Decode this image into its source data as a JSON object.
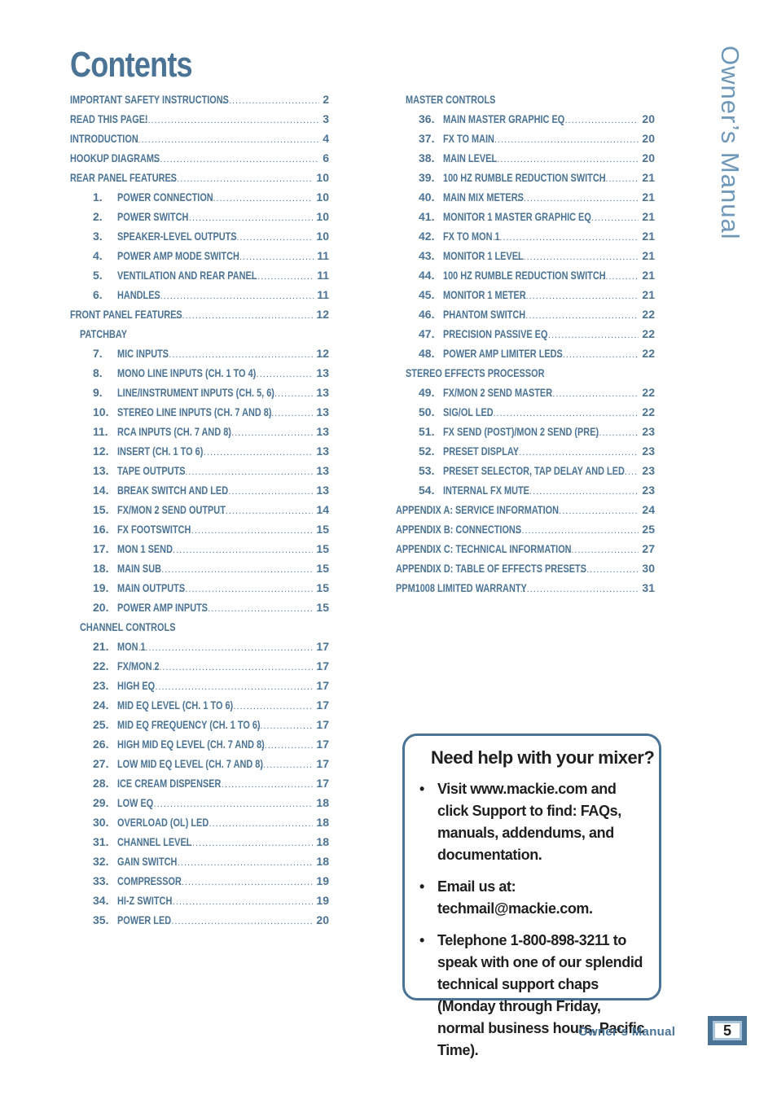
{
  "header": {
    "title": "Contents",
    "side_title": "Owner’s Manual"
  },
  "toc_left": [
    {
      "level": 0,
      "num": "",
      "text": "IMPORTANT SAFETY INSTRUCTIONS",
      "page": "2"
    },
    {
      "level": 0,
      "num": "",
      "text": "READ THIS PAGE!",
      "page": "3"
    },
    {
      "level": 0,
      "num": "",
      "text": "INTRODUCTION",
      "page": "4"
    },
    {
      "level": 0,
      "num": "",
      "text": "HOOKUP DIAGRAMS",
      "page": "6"
    },
    {
      "level": 0,
      "num": "",
      "text": "REAR PANEL FEATURES",
      "page": "10"
    },
    {
      "level": 2,
      "num": "1.",
      "text": "POWER CONNECTION",
      "page": "10"
    },
    {
      "level": 2,
      "num": "2.",
      "text": "POWER SWITCH",
      "page": "10"
    },
    {
      "level": 2,
      "num": "3.",
      "text": "SPEAKER-LEVEL OUTPUTS",
      "page": "10"
    },
    {
      "level": 2,
      "num": "4.",
      "text": "POWER AMP MODE SWITCH",
      "page": "11"
    },
    {
      "level": 2,
      "num": "5.",
      "text": "VENTILATION AND REAR PANEL",
      "page": "11"
    },
    {
      "level": 2,
      "num": "6.",
      "text": "HANDLES",
      "page": "11"
    },
    {
      "level": 0,
      "num": "",
      "text": "FRONT PANEL FEATURES",
      "page": "12"
    },
    {
      "level": 1,
      "num": "",
      "text": "PATCHBAY",
      "page": ""
    },
    {
      "level": 2,
      "num": "7.",
      "text": "MIC INPUTS",
      "page": "12"
    },
    {
      "level": 2,
      "num": "8.",
      "text": "MONO LINE INPUTS (CH. 1 TO 4)",
      "page": "13"
    },
    {
      "level": 2,
      "num": "9.",
      "text": "LINE/INSTRUMENT INPUTS (CH. 5, 6)",
      "page": "13"
    },
    {
      "level": 2,
      "num": "10.",
      "text": "STEREO LINE INPUTS (CH. 7 AND 8)",
      "page": "13"
    },
    {
      "level": 2,
      "num": "11.",
      "text": "RCA INPUTS (CH. 7 AND 8)",
      "page": "13"
    },
    {
      "level": 2,
      "num": "12.",
      "text": "INSERT (CH. 1 TO 6)",
      "page": "13"
    },
    {
      "level": 2,
      "num": "13.",
      "text": "TAPE OUTPUTS",
      "page": "13"
    },
    {
      "level": 2,
      "num": "14.",
      "text": "BREAK SWITCH AND LED",
      "page": "13"
    },
    {
      "level": 2,
      "num": "15.",
      "text": "FX/MON 2 SEND OUTPUT",
      "page": "14"
    },
    {
      "level": 2,
      "num": "16.",
      "text": "FX FOOTSWITCH",
      "page": "15"
    },
    {
      "level": 2,
      "num": "17.",
      "text": "MON 1 SEND",
      "page": "15"
    },
    {
      "level": 2,
      "num": "18.",
      "text": "MAIN SUB",
      "page": "15"
    },
    {
      "level": 2,
      "num": "19.",
      "text": "MAIN OUTPUTS",
      "page": "15"
    },
    {
      "level": 2,
      "num": "20.",
      "text": "POWER AMP INPUTS",
      "page": "15"
    },
    {
      "level": 1,
      "num": "",
      "text": "CHANNEL CONTROLS",
      "page": ""
    },
    {
      "level": 2,
      "num": "21.",
      "text": "MON 1",
      "page": "17"
    },
    {
      "level": 2,
      "num": "22.",
      "text": "FX/MON 2",
      "page": "17"
    },
    {
      "level": 2,
      "num": "23.",
      "text": "HIGH EQ",
      "page": "17"
    },
    {
      "level": 2,
      "num": "24.",
      "text": "MID EQ LEVEL (CH. 1 TO 6)",
      "page": "17"
    },
    {
      "level": 2,
      "num": "25.",
      "text": "MID EQ FREQUENCY (CH. 1 TO 6)",
      "page": "17"
    },
    {
      "level": 2,
      "num": "26.",
      "text": "HIGH MID EQ LEVEL (CH. 7 AND 8)",
      "page": "17"
    },
    {
      "level": 2,
      "num": "27.",
      "text": "LOW MID EQ LEVEL (CH. 7 AND 8)",
      "page": "17"
    },
    {
      "level": 2,
      "num": "28.",
      "text": "ICE CREAM DISPENSER",
      "page": "17"
    },
    {
      "level": 2,
      "num": "29.",
      "text": "LOW EQ",
      "page": "18"
    },
    {
      "level": 2,
      "num": "30.",
      "text": "OVERLOAD (OL) LED",
      "page": "18"
    },
    {
      "level": 2,
      "num": "31.",
      "text": "CHANNEL LEVEL",
      "page": "18"
    },
    {
      "level": 2,
      "num": "32.",
      "text": "GAIN SWITCH",
      "page": "18"
    },
    {
      "level": 2,
      "num": "33.",
      "text": "COMPRESSOR",
      "page": "19"
    },
    {
      "level": 2,
      "num": "34.",
      "text": "HI-Z SWITCH",
      "page": "19"
    },
    {
      "level": 2,
      "num": "35.",
      "text": "POWER LED",
      "page": "20"
    }
  ],
  "toc_right": [
    {
      "level": 1,
      "num": "",
      "text": "MASTER CONTROLS",
      "page": ""
    },
    {
      "level": 2,
      "num": "36.",
      "text": "MAIN MASTER GRAPHIC EQ",
      "page": "20"
    },
    {
      "level": 2,
      "num": "37.",
      "text": "FX TO MAIN",
      "page": "20"
    },
    {
      "level": 2,
      "num": "38.",
      "text": "MAIN LEVEL",
      "page": "20"
    },
    {
      "level": 2,
      "num": "39.",
      "text": "100 HZ RUMBLE REDUCTION SWITCH",
      "page": "21"
    },
    {
      "level": 2,
      "num": "40.",
      "text": "MAIN MIX METERS",
      "page": "21"
    },
    {
      "level": 2,
      "num": "41.",
      "text": "MONITOR 1 MASTER GRAPHIC EQ",
      "page": "21"
    },
    {
      "level": 2,
      "num": "42.",
      "text": "FX TO MON 1",
      "page": "21"
    },
    {
      "level": 2,
      "num": "43.",
      "text": "MONITOR 1 LEVEL",
      "page": "21"
    },
    {
      "level": 2,
      "num": "44.",
      "text": "100 HZ RUMBLE REDUCTION SWITCH",
      "page": "21"
    },
    {
      "level": 2,
      "num": "45.",
      "text": "MONITOR 1 METER",
      "page": "21"
    },
    {
      "level": 2,
      "num": "46.",
      "text": "PHANTOM SWITCH",
      "page": "22"
    },
    {
      "level": 2,
      "num": "47.",
      "text": "PRECISION PASSIVE EQ",
      "page": "22"
    },
    {
      "level": 2,
      "num": "48.",
      "text": "POWER AMP LIMITER LEDS",
      "page": "22"
    },
    {
      "level": 1,
      "num": "",
      "text": "STEREO EFFECTS PROCESSOR",
      "page": ""
    },
    {
      "level": 2,
      "num": "49.",
      "text": "FX/MON 2 SEND MASTER",
      "page": "22"
    },
    {
      "level": 2,
      "num": "50.",
      "text": "SIG/OL LED",
      "page": "22"
    },
    {
      "level": 2,
      "num": "51.",
      "text": "FX SEND (POST)/MON 2 SEND (PRE)",
      "page": "23"
    },
    {
      "level": 2,
      "num": "52.",
      "text": "PRESET DISPLAY",
      "page": "23"
    },
    {
      "level": 2,
      "num": "53.",
      "text": "PRESET SELECTOR, TAP DELAY AND LED",
      "page": "23"
    },
    {
      "level": 2,
      "num": "54.",
      "text": "INTERNAL FX MUTE",
      "page": "23"
    },
    {
      "level": 0,
      "num": "",
      "text": "APPENDIX A: SERVICE INFORMATION",
      "page": "24"
    },
    {
      "level": 0,
      "num": "",
      "text": "APPENDIX B: CONNECTIONS",
      "page": "25"
    },
    {
      "level": 0,
      "num": "",
      "text": "APPENDIX C: TECHNICAL INFORMATION",
      "page": "27"
    },
    {
      "level": 0,
      "num": "",
      "text": "APPENDIX D: TABLE OF EFFECTS PRESETS",
      "page": "30"
    },
    {
      "level": 0,
      "num": "",
      "text": "PPM1008 LIMITED WARRANTY",
      "page": "31"
    }
  ],
  "help_box": {
    "title": "Need help with your mixer?",
    "bullet": "•",
    "items": [
      "Visit www.mackie.com and click Support to find: FAQs, manuals, addendums, and documentation.",
      "Email us at: techmail@mackie.com.",
      "Telephone 1-800-898-3211 to speak with one of our splendid technical support chaps (Monday through Friday, normal business hours, Pacific Time)."
    ]
  },
  "footer": {
    "label": "Owner’s Manual",
    "page_number": "5"
  },
  "colors": {
    "accent": "#4a7396",
    "side_title": "#6f97b8",
    "body_text": "#1f1f1f"
  }
}
